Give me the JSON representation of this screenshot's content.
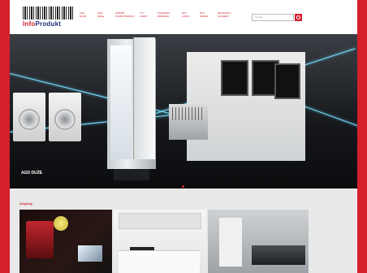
{
  "header": {
    "logo_text_1": "Info",
    "logo_text_2": "Produkt",
    "nav": [
      "AGD duże",
      "AGD małe",
      "Sprzęt komputerowy",
      "TV i Audio",
      "Ochrona zdrowia",
      "RTV Audio",
      "RTV Wideo",
      "Drukarki i skanery"
    ],
    "search_placeholder": "Szukaj"
  },
  "hero": {
    "label": "AGD DUŻE"
  },
  "content": {
    "section_title": "Artykuły"
  },
  "colors": {
    "brand_red": "#d4202a",
    "logo_blue": "#1f2f7a",
    "beam": "#7fe2ff"
  }
}
